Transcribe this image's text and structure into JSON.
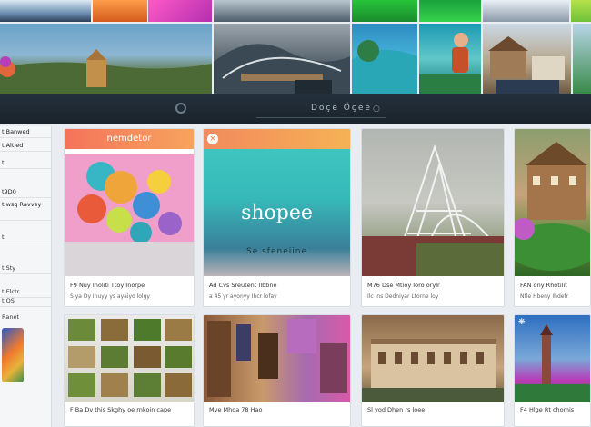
{
  "topbar": {
    "nav_label": "",
    "search_text": "Döçé Öçéé"
  },
  "sidebar": {
    "items": [
      {
        "label": "t Banwed"
      },
      {
        "label": "t Altied"
      },
      {
        "label": "t"
      },
      {
        "label": "t9D0"
      },
      {
        "label": "t wsq Ravvey"
      },
      {
        "label": "t"
      },
      {
        "label": "t Sty"
      },
      {
        "label": "t Elctr"
      },
      {
        "label": "t OS"
      },
      {
        "label": "Ranet"
      }
    ]
  },
  "cards": [
    {
      "header": "nemdetor",
      "caption": "F9 Nuy Inoliti Ttoy Inorpe",
      "meta": "S ya Dy Inuyy ys ayaiyo lolgy"
    },
    {
      "brand": "shopee",
      "sub": "Se sfeneiine",
      "caption": "Ad Cvs Sreutent Ilbbne",
      "meta": "a 45 yr ayonyy Ihcr lofay"
    },
    {
      "caption": "M76 Dse Mtioy Ioro orylr",
      "meta": "Ilc lns Dedniyar Ltorne loy"
    },
    {
      "caption": "FAN dny Rhotilit",
      "meta": "Ntle Hbeny Ihdefr"
    }
  ],
  "bottom_cards": [
    {
      "caption": "F Ba Dv this Skghy oe rnkoin cape"
    },
    {
      "caption": "Mye Mhoa 78 Hao"
    },
    {
      "caption": "Sl yod Dhen rs loee"
    },
    {
      "caption": "F4 Hlge Rt chomis"
    }
  ]
}
